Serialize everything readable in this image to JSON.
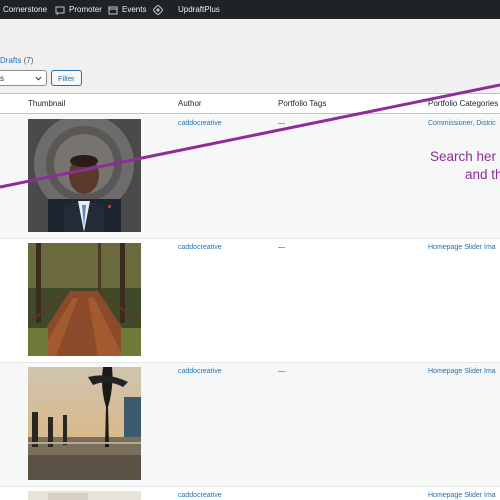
{
  "adminbar": {
    "items": [
      {
        "label": "Cornerstone",
        "icon": "cornerstone-icon"
      },
      {
        "label": "Promoter",
        "icon": "promoter-icon"
      },
      {
        "label": "Events",
        "icon": "calendar-icon"
      },
      {
        "label": "",
        "icon": "diamond-icon"
      },
      {
        "label": "UpdraftPlus",
        "icon": ""
      }
    ]
  },
  "subsubsub": {
    "drafts_label": "Drafts",
    "drafts_count": "(7)"
  },
  "filters": {
    "select_value": "s",
    "filter_button": "Filter"
  },
  "table": {
    "columns": [
      "Thumbnail",
      "Author",
      "Portfolio Tags",
      "Portfolio Categories"
    ],
    "rows": [
      {
        "thumbnail": "portrait of a man in suit before a seal",
        "author": "caddocreative",
        "tags": "—",
        "categories": "Commissioner, Distric"
      },
      {
        "thumbnail": "leaf-covered wooden boardwalk in a forest",
        "author": "caddocreative",
        "tags": "—",
        "categories": "Homepage Slider Ima"
      },
      {
        "thumbnail": "cypress trees in a lake at sunset",
        "author": "caddocreative",
        "tags": "—",
        "categories": "Homepage Slider Ima"
      },
      {
        "thumbnail": "",
        "author": "caddocreative",
        "tags": "",
        "categories": "Homepage Slider Ima"
      }
    ]
  },
  "annotation": {
    "line1": "Search her",
    "line2": "and th",
    "color": "#8e2c9a"
  },
  "colors": {
    "adminbar": "#1d2327",
    "link": "#2271b1",
    "background": "#f0f0f1"
  }
}
